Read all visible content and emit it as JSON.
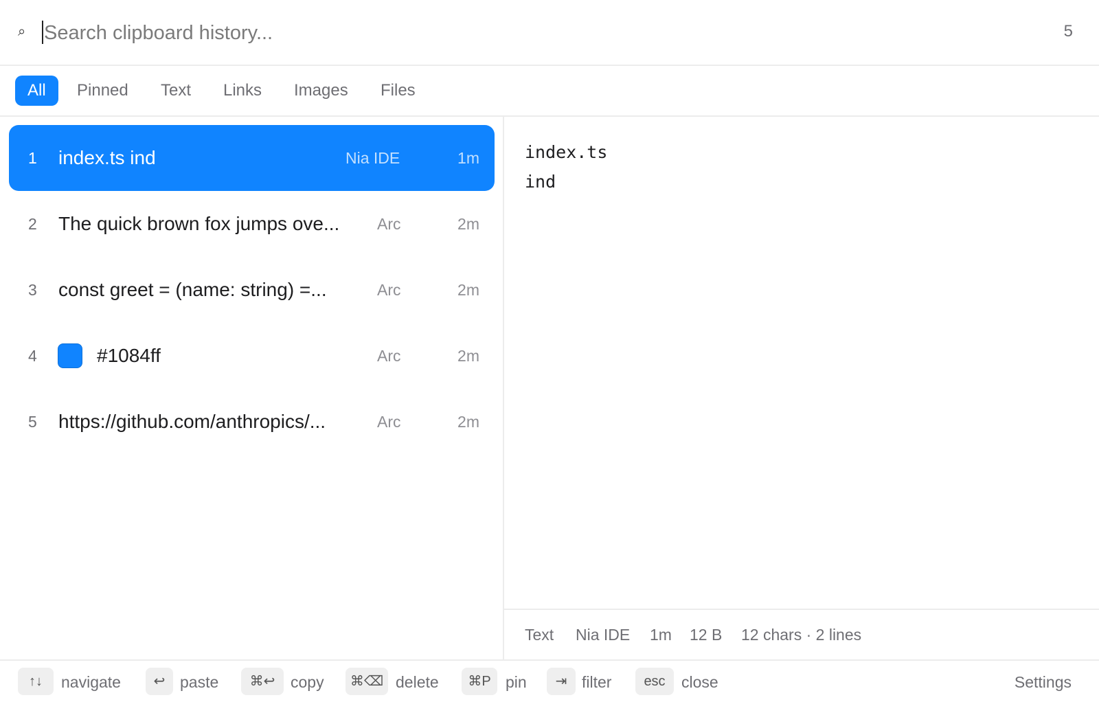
{
  "search": {
    "placeholder": "Search clipboard history...",
    "value": "",
    "count": "5",
    "icon": "magnifier-icon"
  },
  "tabs": [
    {
      "label": "All",
      "active": true
    },
    {
      "label": "Pinned",
      "active": false
    },
    {
      "label": "Text",
      "active": false
    },
    {
      "label": "Links",
      "active": false
    },
    {
      "label": "Images",
      "active": false
    },
    {
      "label": "Files",
      "active": false
    }
  ],
  "items": [
    {
      "index": "1",
      "content": "index.ts ind",
      "app": "Nia IDE",
      "time": "1m",
      "selected": true
    },
    {
      "index": "2",
      "content": "The quick brown fox jumps ove...",
      "app": "Arc",
      "time": "2m",
      "selected": false
    },
    {
      "index": "3",
      "content": "const greet = (name: string) =...",
      "app": "Arc",
      "time": "2m",
      "selected": false
    },
    {
      "index": "4",
      "content": "#1084ff",
      "app": "Arc",
      "time": "2m",
      "selected": false,
      "swatch": "#1084ff"
    },
    {
      "index": "5",
      "content": "https://github.com/anthropics/...",
      "app": "Arc",
      "time": "2m",
      "selected": false
    }
  ],
  "preview": {
    "text": "index.ts\nind",
    "meta": {
      "type": "Text",
      "app": "Nia IDE",
      "time": "1m",
      "size": "12 B",
      "stats": "12 chars · 2 lines"
    }
  },
  "footer": {
    "hints": [
      {
        "key": "↑↓",
        "label": "navigate"
      },
      {
        "key": "↩",
        "label": "paste"
      },
      {
        "key": "⌘↩",
        "label": "copy"
      },
      {
        "key": "⌘⌫",
        "label": "delete"
      },
      {
        "key": "⌘P",
        "label": "pin"
      },
      {
        "key": "⇥",
        "label": "filter"
      },
      {
        "key": "esc",
        "label": "close"
      }
    ],
    "settings": "Settings"
  },
  "colors": {
    "accent": "#1084ff",
    "border": "#ececec",
    "muted_text": "#6e6e73"
  }
}
